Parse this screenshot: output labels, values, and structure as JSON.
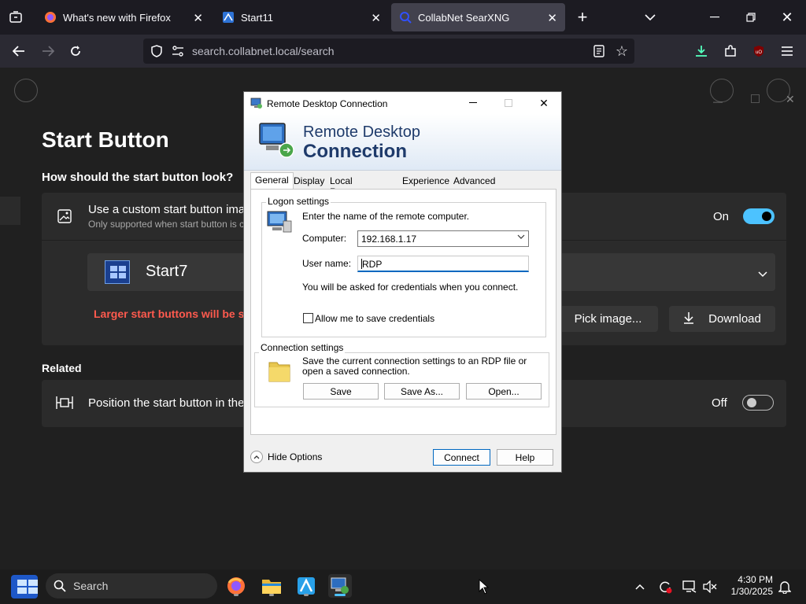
{
  "browser": {
    "tabs": [
      {
        "label": "What's new with Firefox"
      },
      {
        "label": "Start11"
      },
      {
        "label": "CollabNet SearXNG"
      }
    ],
    "url": "search.collabnet.local/search"
  },
  "app": {
    "page_title": "Start Button",
    "question": "How should the start button look?",
    "custom_option": {
      "title": "Use a custom start button ima",
      "subtitle": "Only supported when start button is c",
      "state_label": "On"
    },
    "selected_style": "Start7",
    "warning": "Larger start buttons will be sl",
    "pick_image_label": "Pick image...",
    "download_label": "Download",
    "related_heading": "Related",
    "position_option": {
      "title": "Position the start button in the",
      "state_label": "Off"
    }
  },
  "dialog": {
    "title": "Remote Desktop Connection",
    "banner_line1": "Remote Desktop",
    "banner_line2": "Connection",
    "tabs": [
      "General",
      "Display",
      "Local Resources",
      "Experience",
      "Advanced"
    ],
    "selected_tab": "General",
    "logon": {
      "heading": "Logon settings",
      "prompt": "Enter the name of the remote computer.",
      "computer_label": "Computer:",
      "computer_value": "192.168.1.17",
      "username_label": "User name:",
      "username_value": "RDP",
      "credentials_note": "You will be asked for credentials when you connect.",
      "save_credentials_label": "Allow me to save credentials",
      "save_credentials_checked": false
    },
    "connection": {
      "heading": "Connection settings",
      "description": "Save the current connection settings to an RDP file or open a saved connection.",
      "save_label": "Save",
      "save_as_label": "Save As...",
      "open_label": "Open..."
    },
    "hide_options_label": "Hide Options",
    "connect_label": "Connect",
    "help_label": "Help"
  },
  "taskbar": {
    "search_label": "Search",
    "time": "4:30 PM",
    "date": "1/30/2025"
  },
  "colors": {
    "accent": "#4cc2ff",
    "warning": "#ff5a4e",
    "dialog_title": "#1f3b6b"
  }
}
